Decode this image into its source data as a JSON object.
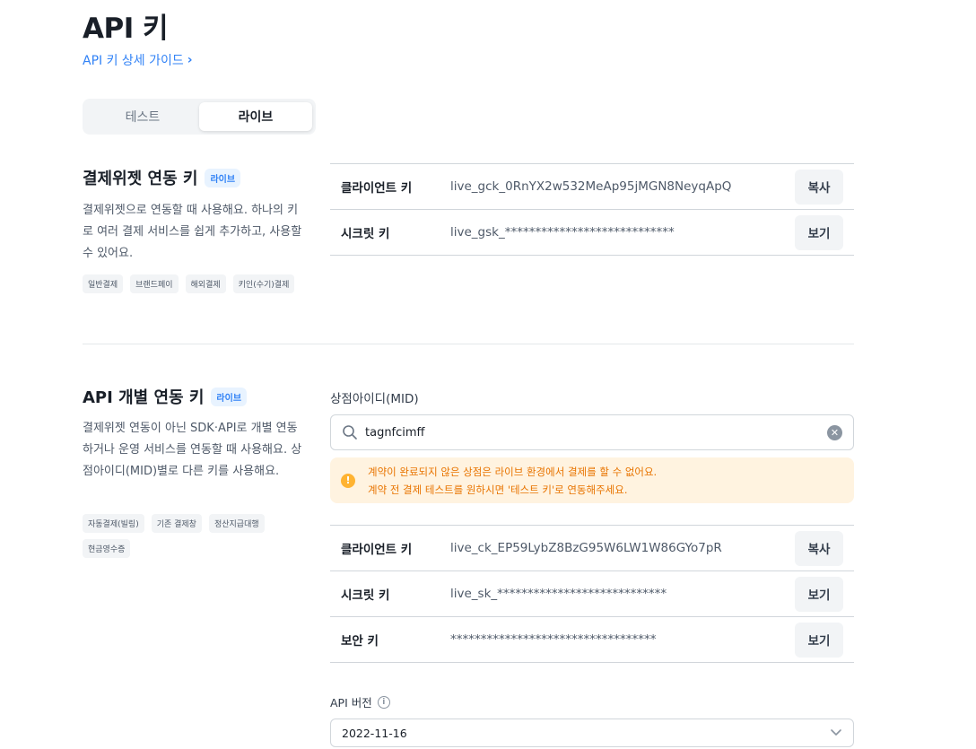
{
  "header": {
    "title": "API 키",
    "guide_link": "API 키 상세 가이드",
    "guide_chevron": "›"
  },
  "env_tabs": [
    {
      "label": "테스트",
      "active": false
    },
    {
      "label": "라이브",
      "active": true
    }
  ],
  "widget_section": {
    "title": "결제위젯 연동 키",
    "badge": "라이브",
    "description": "결제위젯으로 연동할 때 사용해요. 하나의 키로 여러 결제 서비스를 쉽게 추가하고, 사용할 수 있어요.",
    "chips": [
      "일반결제",
      "브랜드페이",
      "해외결제",
      "키인(수기)결제"
    ],
    "keys": [
      {
        "label": "클라이언트 키",
        "value": "live_gck_0RnYX2w532MeAp95jMGN8NeyqApQ",
        "button": "복사"
      },
      {
        "label": "시크릿 키",
        "value": "live_gsk_****************************",
        "button": "보기"
      }
    ]
  },
  "api_section": {
    "title": "API 개별 연동 키",
    "badge": "라이브",
    "description": "결제위젯 연동이 아닌 SDK·API로 개별 연동하거나 운영 서비스를 연동할 때 사용해요. 상점아이디(MID)별로 다른 키를 사용해요.",
    "chips": [
      "자동결제(빌링)",
      "기존 결제창",
      "정산지급대행",
      "현금영수증"
    ],
    "mid_label": "상점아이디(MID)",
    "mid_value": "tagnfcimff",
    "warning_line1": "계약이 완료되지 않은 상점은 라이브 환경에서 결제를 할 수 없어요.",
    "warning_line2": "계약 전 결제 테스트를 원하시면 '테스트 키'로 연동해주세요.",
    "keys": [
      {
        "label": "클라이언트 키",
        "value": "live_ck_EP59LybZ8BzG95W6LW1W86GYo7pR",
        "button": "복사"
      },
      {
        "label": "시크릿 키",
        "value": "live_sk_****************************",
        "button": "보기"
      },
      {
        "label": "보안 키",
        "value": "**********************************",
        "button": "보기"
      }
    ],
    "api_version_label": "API 버전",
    "api_version_value": "2022-11-16"
  },
  "icons": {
    "search": "search-icon",
    "clear": "clear-icon",
    "warning": "warning-icon",
    "info": "info-icon",
    "chevron_down": "chevron-down-icon"
  },
  "colors": {
    "accent": "#3182f6",
    "badge_bg": "#e8f3ff",
    "warning_bg": "#fff3e0",
    "warning_text": "#e87400",
    "warning_icon": "#ffb331"
  }
}
